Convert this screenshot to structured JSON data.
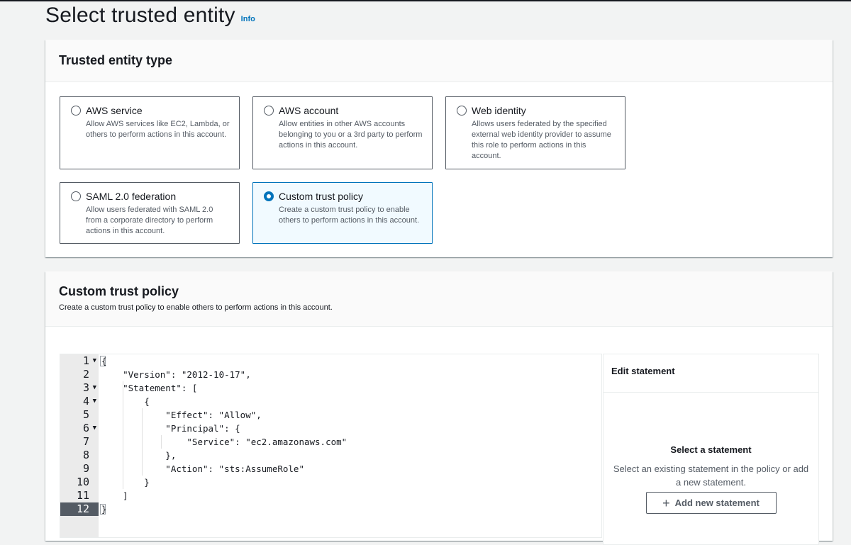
{
  "page": {
    "title": "Select trusted entity",
    "info_link": "Info"
  },
  "trusted_entity": {
    "heading": "Trusted entity type",
    "options": [
      {
        "title": "AWS service",
        "description": "Allow AWS services like EC2, Lambda, or others to perform actions in this account.",
        "selected": false
      },
      {
        "title": "AWS account",
        "description": "Allow entities in other AWS accounts belonging to you or a 3rd party to perform actions in this account.",
        "selected": false
      },
      {
        "title": "Web identity",
        "description": "Allows users federated by the specified external web identity provider to assume this role to perform actions in this account.",
        "selected": false
      },
      {
        "title": "SAML 2.0 federation",
        "description": "Allow users federated with SAML 2.0 from a corporate directory to perform actions in this account.",
        "selected": false
      },
      {
        "title": "Custom trust policy",
        "description": "Create a custom trust policy to enable others to perform actions in this account.",
        "selected": true
      }
    ]
  },
  "custom_policy": {
    "heading": "Custom trust policy",
    "description": "Create a custom trust policy to enable others to perform actions in this account.",
    "editor": {
      "line_numbers": [
        "1",
        "2",
        "3",
        "4",
        "5",
        "6",
        "7",
        "8",
        "9",
        "10",
        "11",
        "12"
      ],
      "active_line": "12",
      "lines": [
        "{",
        "    \"Version\": \"2012-10-17\",",
        "    \"Statement\": [",
        "        {",
        "            \"Effect\": \"Allow\",",
        "            \"Principal\": {",
        "                \"Service\": \"ec2.amazonaws.com\"",
        "            },",
        "            \"Action\": \"sts:AssumeRole\"",
        "        }",
        "    ]",
        "}"
      ]
    },
    "side_panel": {
      "header": "Edit statement",
      "empty_title": "Select a statement",
      "empty_text": "Select an existing statement in the policy or add a new statement.",
      "add_button": "Add new statement"
    }
  },
  "colors": {
    "accent": "#0073bb",
    "selected_bg": "#f1faff",
    "text": "#16191f",
    "muted": "#545b64"
  }
}
